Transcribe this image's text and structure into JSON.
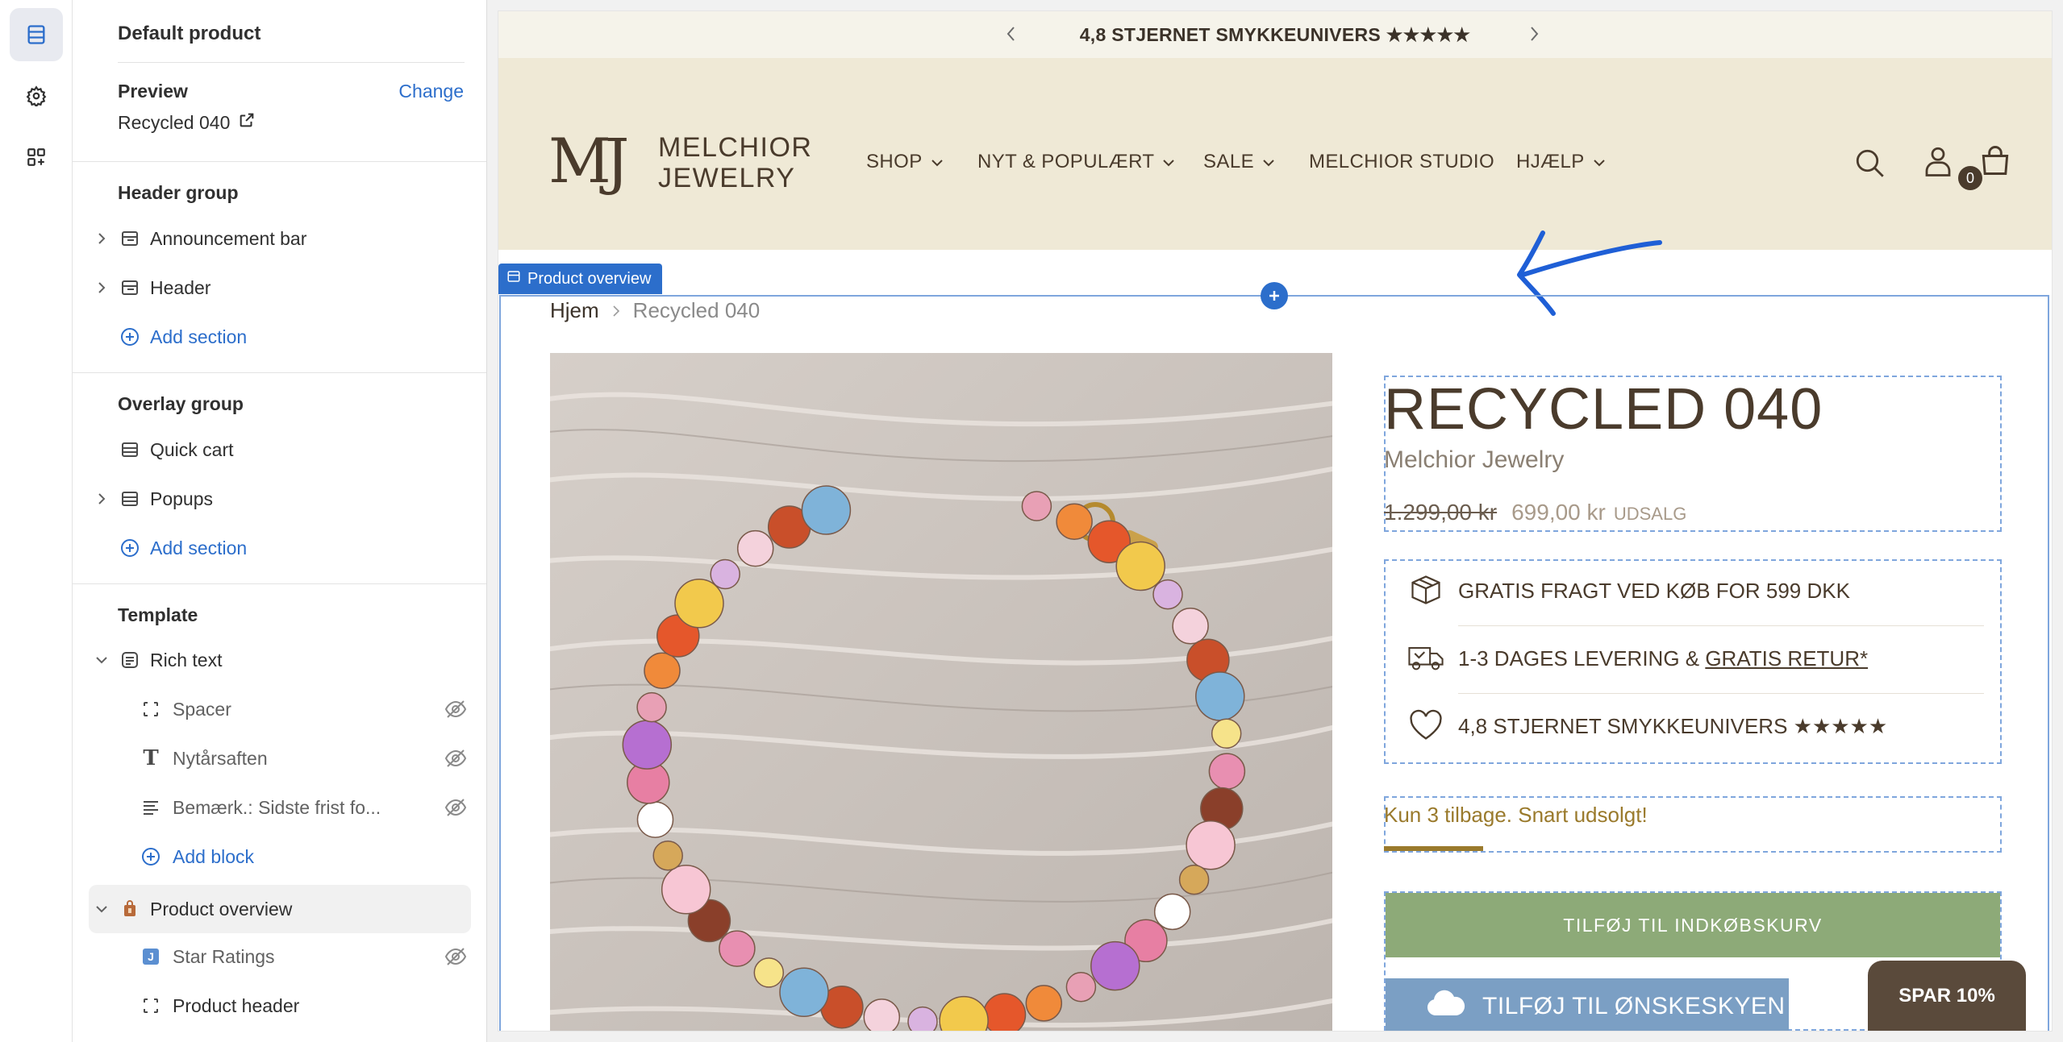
{
  "panel": {
    "title": "Default product",
    "preview_label": "Preview",
    "change_label": "Change",
    "preview_value": "Recycled 040",
    "header_group": {
      "title": "Header group",
      "items": [
        "Announcement bar",
        "Header"
      ],
      "add_label": "Add section"
    },
    "overlay_group": {
      "title": "Overlay group",
      "items": [
        "Quick cart",
        "Popups"
      ],
      "add_label": "Add section"
    },
    "template": {
      "title": "Template",
      "rich_text": "Rich text",
      "blocks": [
        "Spacer",
        "Nytårsaften",
        "Bemærk.: Sidste frist fo..."
      ],
      "add_block": "Add block",
      "product_overview": "Product overview",
      "po_blocks": [
        "Star Ratings",
        "Product header"
      ]
    }
  },
  "store": {
    "announcement": "4,8 STJERNET SMYKKEUNIVERS ★★★★★",
    "logo_mark": "MJ",
    "logo_line1": "MELCHIOR",
    "logo_line2": "JEWELRY",
    "nav": [
      "SHOP",
      "NYT & POPULÆRT",
      "SALE",
      "MELCHIOR STUDIO",
      "HJÆLP"
    ],
    "cart_count": "0",
    "section_tag": "Product overview",
    "breadcrumb_home": "Hjem",
    "breadcrumb_current": "Recycled 040",
    "product_title": "RECYCLED 040",
    "vendor": "Melchior Jewelry",
    "compare_price": "1.299,00 kr",
    "price": "699,00 kr",
    "sale_badge": "UDSALG",
    "feature1": "GRATIS FRAGT VED KØB FOR 599 DKK",
    "feature2_prefix": "1-3 DAGES LEVERING & ",
    "feature2_link": "GRATIS RETUR*",
    "feature3": "4,8 STJERNET SMYKKEUNIVERS ★★★★★",
    "stock": "Kun 3 tilbage. Snart udsolgt!",
    "stock_level": 0.16,
    "add_to_cart": "TILFØJ TIL INDKØBSKURV",
    "wishlist": "TILFØJ TIL ØNSKESKYEN",
    "save_badge": "SPAR 10%"
  },
  "colors": {
    "accent": "#2c6ecb",
    "header_bg": "#efe9d6",
    "brand_brown": "#4a3b2c",
    "cart_green": "#8daa78",
    "wishlist_blue": "#7b9fc4",
    "stock_gold": "#9a7a2c"
  }
}
